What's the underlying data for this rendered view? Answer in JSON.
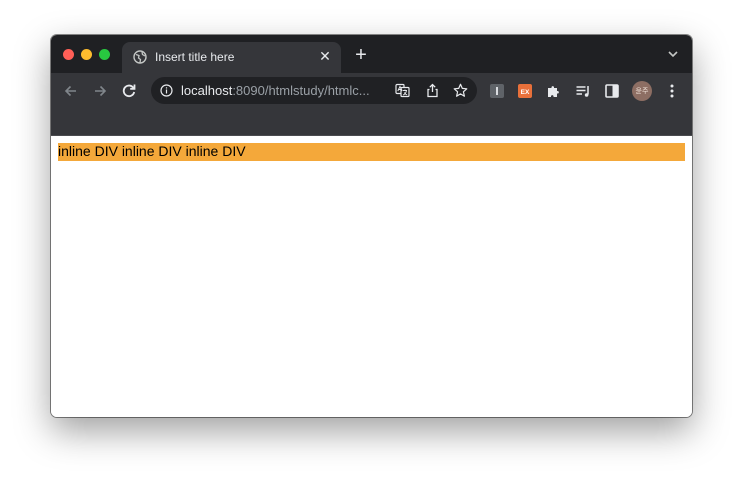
{
  "window": {
    "traffic_lights": [
      "#ff5f57",
      "#febc2e",
      "#28c840"
    ]
  },
  "tab": {
    "title": "Insert title here",
    "favicon": "globe-icon",
    "close_glyph": "✕"
  },
  "new_tab": {
    "glyph": "+"
  },
  "toolbar": {
    "back_icon": "arrow-left-icon",
    "forward_icon": "arrow-right-icon",
    "reload_icon": "reload-icon",
    "url_host": "localhost",
    "url_rest": ":8090/htmlstudy/htmlc...",
    "omnibox_icons": [
      "translate-icon",
      "share-icon",
      "star-icon"
    ],
    "extensions": [
      {
        "name": "i-extension-icon",
        "label": "I",
        "color": "#5f6368"
      },
      {
        "name": "ex-extension-icon",
        "label": "EX",
        "color": "#e8703a"
      },
      {
        "name": "puzzle-icon"
      },
      {
        "name": "reading-list-icon"
      },
      {
        "name": "side-panel-icon"
      }
    ],
    "avatar_label": "윤주",
    "menu_icon": "kebab-menu-icon"
  },
  "page": {
    "divs": [
      "inline DIV",
      "inline DIV",
      "inline DIV"
    ],
    "div_background": "#f4a83a"
  }
}
